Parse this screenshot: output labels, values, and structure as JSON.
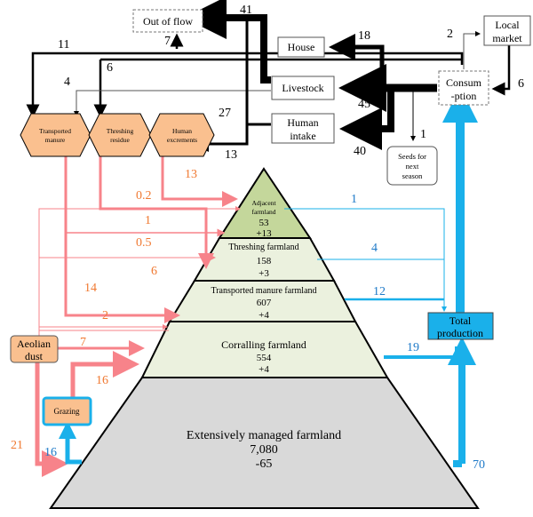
{
  "colors": {
    "black_flow": "#000000",
    "pink_flow": "#f7838a",
    "blue_flow": "#1ab0ea",
    "hexagon": "#fac08f",
    "adjacent": "#c4d79b",
    "middle": "#ebf1de",
    "bottom": "#d9d9d9",
    "total": "#1ab0ea"
  },
  "nodes": {
    "out_of_flow": "Out of flow",
    "house": "House",
    "livestock": "Livestock",
    "human_intake": [
      "Human",
      "intake"
    ],
    "local_market": [
      "Local",
      "market"
    ],
    "consumption": [
      "Consum",
      "-ption"
    ],
    "seeds": [
      "Seeds for",
      "next",
      "season"
    ],
    "transported_manure": [
      "Transported",
      "manure"
    ],
    "threshing_residue": [
      "Threshing",
      "residue"
    ],
    "human_excrements": [
      "Human",
      "excrements"
    ],
    "aeolian_dust": [
      "Aeolian",
      "dust"
    ],
    "grazing": "Grazing",
    "total_production": [
      "Total",
      "production"
    ]
  },
  "pyramid": {
    "adjacent": {
      "label": [
        "Adjacent",
        "farmland"
      ],
      "area": "53",
      "change": "+13"
    },
    "threshing": {
      "label": "Threshing farmland",
      "area": "158",
      "change": "+3"
    },
    "transported": {
      "label": "Transported manure farmland",
      "area": "607",
      "change": "+4"
    },
    "corralling": {
      "label": "Corralling farmland",
      "area": "554",
      "change": "+4"
    },
    "extensive": {
      "label": "Extensively managed farmland",
      "area": "7,080",
      "change": "-65"
    }
  },
  "flows": {
    "black": {
      "to_out_of_flow": "41",
      "out_of_flow_up": "7",
      "house": "18",
      "to_transported_manure": "11",
      "to_threshing_residue": "6",
      "livestock_to_manure": "4",
      "livestock_in": "45",
      "human_intake_in": "40",
      "excrements": "13",
      "human_out": "27",
      "to_market": "2",
      "from_market": "6",
      "seeds": "1"
    },
    "pink": {
      "excrements_to_adjacent": "13",
      "residue_to_threshing": "0.2",
      "manure_to_adjacent": "1",
      "dust_to_threshing": "0.5",
      "residue_to_threshing_band": "6",
      "manure_to_transported": "14",
      "dust_to_transported": "2",
      "dust_to_corralling": "7",
      "grazing_to_corralling": "16",
      "dust_to_extensive": "21"
    },
    "blue": {
      "adjacent": "1",
      "threshing": "4",
      "transported": "12",
      "corralling": "19",
      "extensive": "70",
      "grazing": "16"
    }
  }
}
